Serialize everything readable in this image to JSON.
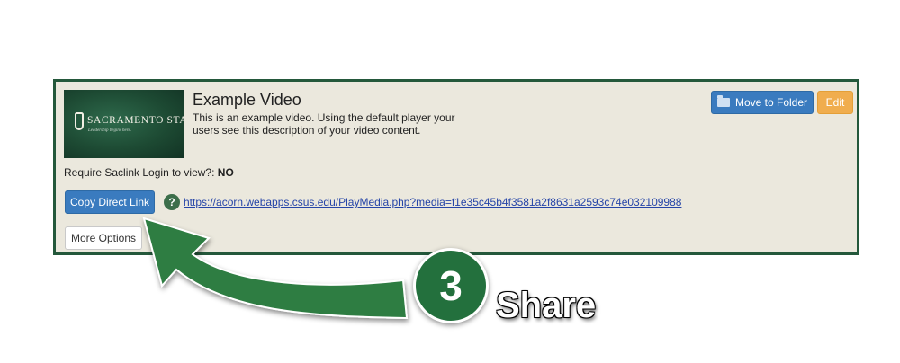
{
  "video": {
    "thumbnail_brand": "SACRAMENTO STATE",
    "thumbnail_tagline": "Leadership begins here.",
    "title": "Example Video",
    "description": "This is an example video. Using the default player your users see this description of your video content."
  },
  "actions": {
    "move_to_folder_label": "Move to Folder",
    "edit_label": "Edit",
    "copy_link_label": "Copy Direct Link",
    "more_options_label": "More Options",
    "help_symbol": "?"
  },
  "access": {
    "label": "Require Saclink Login to view?:",
    "value": "NO"
  },
  "share_link": "https://acorn.webapps.csus.edu/PlayMedia.php?media=f1e35c45b4f3581a2f8631a2593c74e032109988",
  "callout": {
    "step_number": "3",
    "step_label": "Share",
    "color": "#23703d"
  },
  "colors": {
    "panel_border": "#24583b",
    "panel_background": "#ebe8dd",
    "primary_button": "#3a7bbf",
    "warning_button": "#f0ad4e",
    "link": "#2645a8"
  },
  "icons": {
    "folder": "folder-icon",
    "help": "help-icon"
  }
}
